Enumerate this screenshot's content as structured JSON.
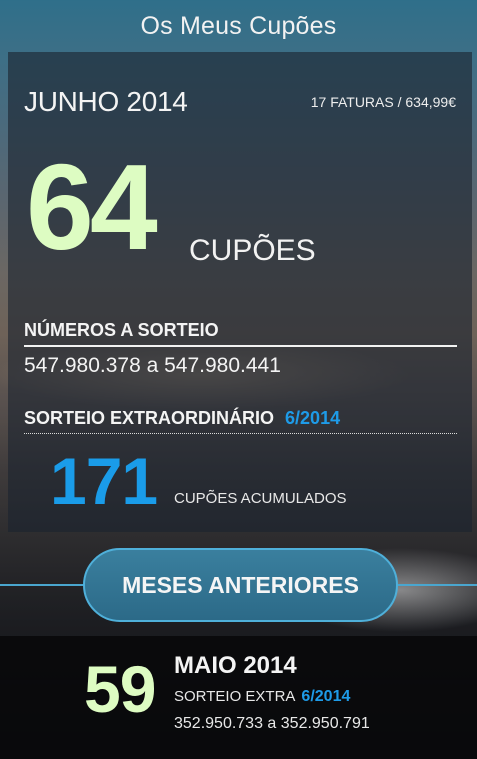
{
  "header": {
    "title": "Os Meus Cupões"
  },
  "current": {
    "month": "JUNHO 2014",
    "invoices": "17 FATURAS / 634,99€",
    "coupon_count": "64",
    "coupon_unit": "CUPÕES",
    "numbers_label": "NÚMEROS A SORTEIO",
    "numbers_range": "547.980.378 a 547.980.441",
    "extra_label": "SORTEIO EXTRAORDINÁRIO",
    "extra_period": "6/2014",
    "accumulated_count": "171",
    "accumulated_label": "CUPÕES ACUMULADOS"
  },
  "previous_button": {
    "label": "MESES ANTERIORES"
  },
  "previous_month": {
    "coupon_count": "59",
    "month": "MAIO 2014",
    "extra_label": "SORTEIO EXTRA",
    "extra_period": "6/2014",
    "numbers_range": "352.950.733 a 352.950.791"
  },
  "colors": {
    "accent_green": "#ddfcc2",
    "accent_blue": "#1a9ce9",
    "button_blue": "#2c6a88"
  }
}
